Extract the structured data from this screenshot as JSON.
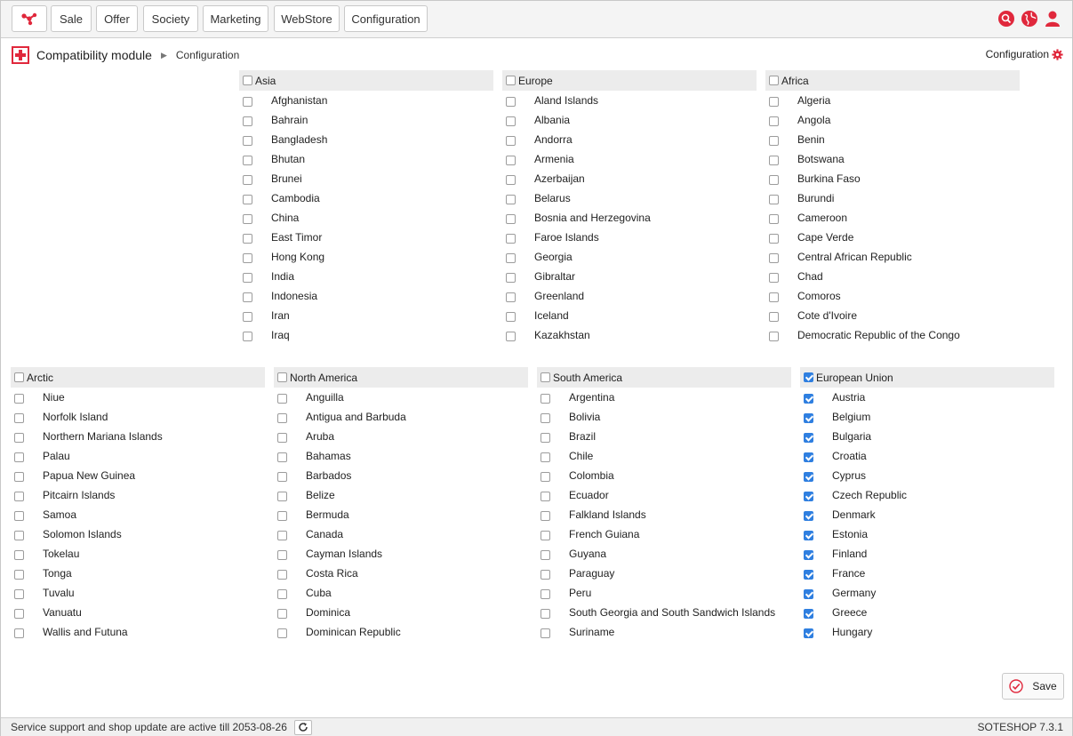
{
  "nav": {
    "items": [
      "Sale",
      "Offer",
      "Society",
      "Marketing",
      "WebStore",
      "Configuration"
    ],
    "icons": [
      "search-icon",
      "globe-icon",
      "user-icon"
    ],
    "accent": "#e0283c"
  },
  "breadcrumb": {
    "module": "Compatibility module",
    "current": "Configuration"
  },
  "config_link": "Configuration",
  "regions": {
    "asia": {
      "name": "Asia",
      "countries": [
        "Afghanistan",
        "Bahrain",
        "Bangladesh",
        "Bhutan",
        "Brunei",
        "Cambodia",
        "China",
        "East Timor",
        "Hong Kong",
        "India",
        "Indonesia",
        "Iran",
        "Iraq"
      ]
    },
    "europe": {
      "name": "Europe",
      "countries": [
        "Aland Islands",
        "Albania",
        "Andorra",
        "Armenia",
        "Azerbaijan",
        "Belarus",
        "Bosnia and Herzegovina",
        "Faroe Islands",
        "Georgia",
        "Gibraltar",
        "Greenland",
        "Iceland",
        "Kazakhstan"
      ]
    },
    "africa": {
      "name": "Africa",
      "countries": [
        "Algeria",
        "Angola",
        "Benin",
        "Botswana",
        "Burkina Faso",
        "Burundi",
        "Cameroon",
        "Cape Verde",
        "Central African Republic",
        "Chad",
        "Comoros",
        "Cote d'Ivoire",
        "Democratic Republic of the Congo"
      ]
    },
    "arctic": {
      "name": "Arctic",
      "countries": [
        "Niue",
        "Norfolk Island",
        "Northern Mariana Islands",
        "Palau",
        "Papua New Guinea",
        "Pitcairn Islands",
        "Samoa",
        "Solomon Islands",
        "Tokelau",
        "Tonga",
        "Tuvalu",
        "Vanuatu",
        "Wallis and Futuna"
      ]
    },
    "north_america": {
      "name": "North America",
      "countries": [
        "Anguilla",
        "Antigua and Barbuda",
        "Aruba",
        "Bahamas",
        "Barbados",
        "Belize",
        "Bermuda",
        "Canada",
        "Cayman Islands",
        "Costa Rica",
        "Cuba",
        "Dominica",
        "Dominican Republic"
      ]
    },
    "south_america": {
      "name": "South America",
      "countries": [
        "Argentina",
        "Bolivia",
        "Brazil",
        "Chile",
        "Colombia",
        "Ecuador",
        "Falkland Islands",
        "French Guiana",
        "Guyana",
        "Paraguay",
        "Peru",
        "South Georgia and South Sandwich Islands",
        "Suriname"
      ]
    },
    "european_union": {
      "name": "European Union",
      "checked": true,
      "countries": [
        "Austria",
        "Belgium",
        "Bulgaria",
        "Croatia",
        "Cyprus",
        "Czech Republic",
        "Denmark",
        "Estonia",
        "Finland",
        "France",
        "Germany",
        "Greece",
        "Hungary"
      ]
    }
  },
  "save_label": "Save",
  "footer": {
    "status": "Service support and shop update are active till 2053-08-26",
    "version": "SOTESHOP 7.3.1"
  }
}
